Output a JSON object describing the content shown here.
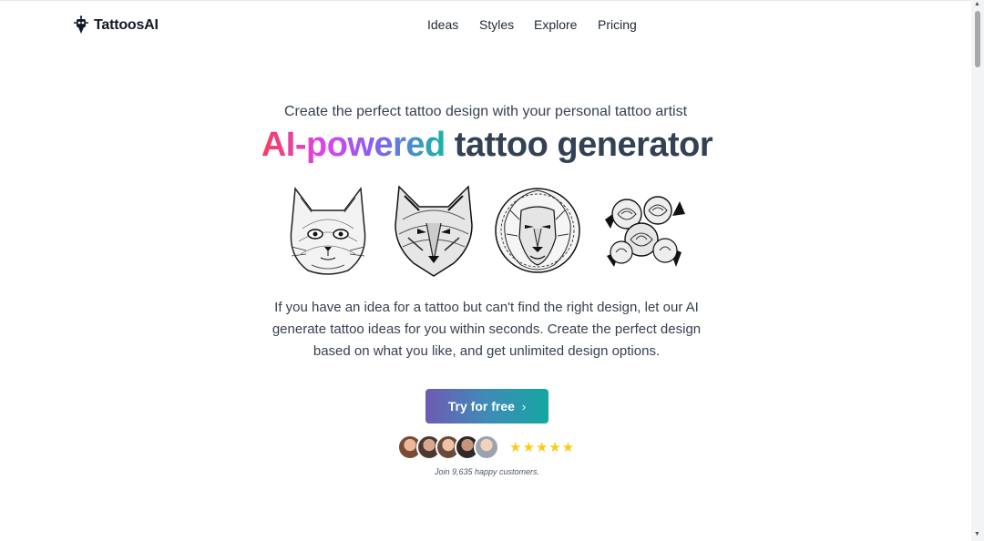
{
  "brand": {
    "name": "TattoosAI",
    "logo_icon": "robot-icon"
  },
  "nav": {
    "items": [
      "Ideas",
      "Styles",
      "Explore",
      "Pricing"
    ]
  },
  "hero": {
    "subtitle": "Create the perfect tattoo design with your personal tattoo artist",
    "headline_accent": "AI-powered",
    "headline_rest": " tattoo generator",
    "description": "If you have an idea for a tattoo but can't find the right design, let our AI generate tattoo ideas for you within seconds. Create the perfect design based on what you like, and get unlimited design options.",
    "cta_label": "Try for free",
    "cta_icon": "chevron-right-icon",
    "rating_stars": 5,
    "stars_text": "★★★★★",
    "social_proof": "Join 9,635 happy customers."
  },
  "gallery": {
    "images": [
      "cat-tattoo",
      "wolf-tattoo",
      "lion-tattoo",
      "roses-tattoo"
    ]
  },
  "colors": {
    "accent_gradient": [
      "#f43f5e",
      "#d946ef",
      "#8b5cf6",
      "#14b8a6"
    ],
    "cta_gradient": [
      "#6d5bb3",
      "#14a7a0"
    ],
    "stars": "#facc15"
  }
}
